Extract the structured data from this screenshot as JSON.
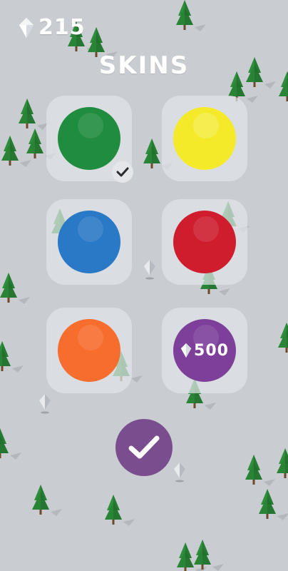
{
  "hud": {
    "gem_count": "215",
    "gem_icon": "diamond-icon"
  },
  "screen": {
    "title": "SKINS"
  },
  "skins": [
    {
      "name": "green",
      "color": "#1f8c3f",
      "state": "selected"
    },
    {
      "name": "yellow",
      "color": "#f5ea2a",
      "state": "owned"
    },
    {
      "name": "blue",
      "color": "#2a79c6",
      "state": "owned"
    },
    {
      "name": "red",
      "color": "#cf1d2e",
      "state": "owned"
    },
    {
      "name": "orange",
      "color": "#f66d2d",
      "state": "owned"
    },
    {
      "name": "purple",
      "color": "#7d3f9a",
      "state": "locked",
      "price": "500"
    }
  ],
  "confirm": {
    "icon": "checkmark-icon",
    "color": "#7a4d8e"
  },
  "colors": {
    "background": "#c9ccd1",
    "tree": "#2e8a3a",
    "tree_dark": "#1f6b2b",
    "trunk": "#6d4a2d"
  }
}
